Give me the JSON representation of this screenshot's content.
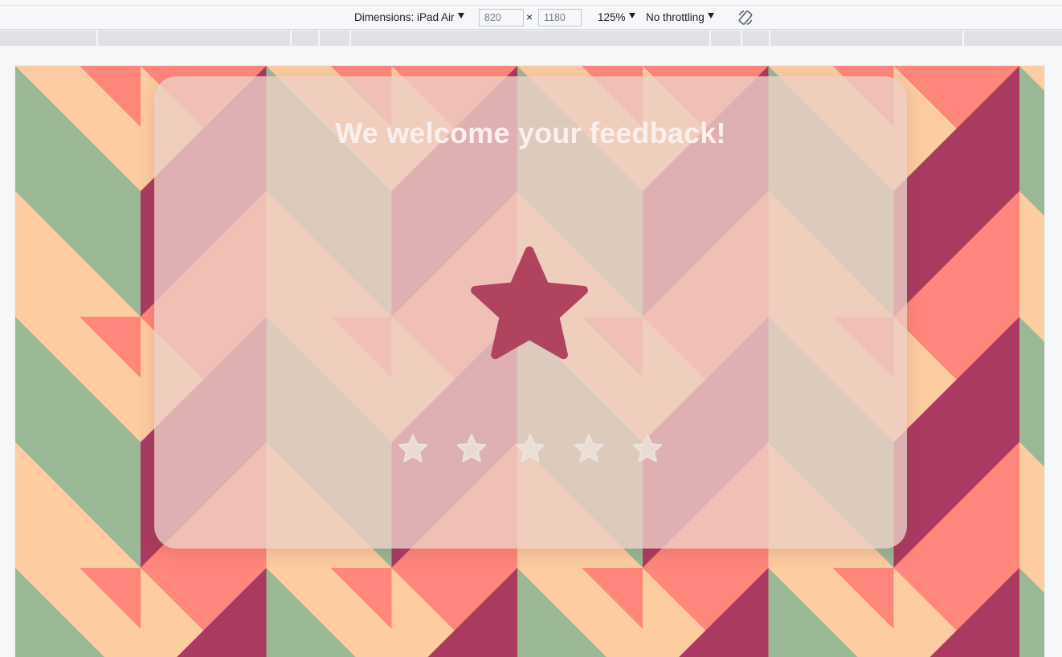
{
  "devtools": {
    "dimensions_label": "Dimensions: iPad Air",
    "width_value": "820",
    "times_symbol": "×",
    "height_value": "1180",
    "zoom": "125%",
    "throttling": "No throttling",
    "rotate_icon": "rotate-icon"
  },
  "page": {
    "title": "We welcome your feedback!",
    "selected_rating": 0,
    "max_rating": 5,
    "colors": {
      "peach": "#fdcca1",
      "coral": "#ff867a",
      "sage": "#9ab896",
      "berry": "#ab3a60",
      "card": "#ecd0c7",
      "big_star": "#b0445f",
      "rating_star": "#ece2dc"
    }
  }
}
